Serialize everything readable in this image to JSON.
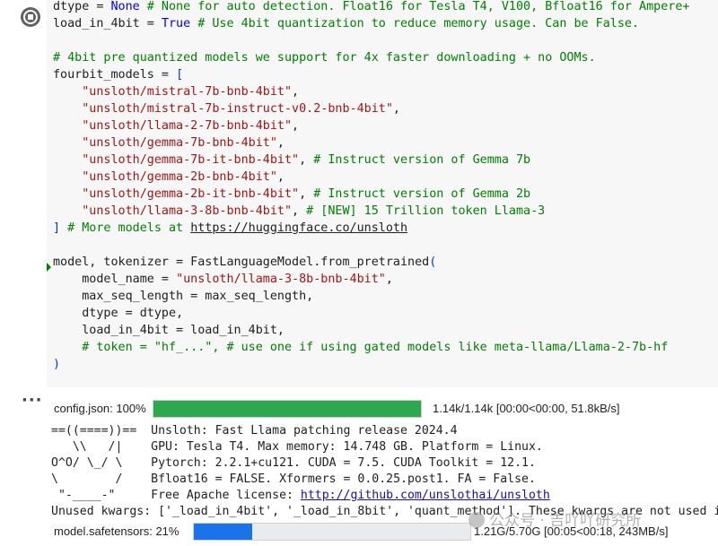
{
  "code": {
    "lines": [
      [
        {
          "t": "dtype = "
        },
        {
          "t": "None",
          "c": "kw"
        },
        {
          "t": " # None for auto detection. Float16 for Tesla T4, V100, Bfloat16 for Ampere+",
          "c": "com"
        }
      ],
      [
        {
          "t": "load_in_4bit = "
        },
        {
          "t": "True",
          "c": "kw"
        },
        {
          "t": " # Use 4bit quantization to reduce memory usage. Can be False.",
          "c": "com"
        }
      ],
      [],
      [
        {
          "t": "# 4bit pre quantized models we support for 4x faster downloading + no OOMs.",
          "c": "com"
        }
      ],
      [
        {
          "t": "fourbit_models = "
        },
        {
          "t": "[",
          "c": "br"
        }
      ],
      [
        {
          "t": "    "
        },
        {
          "t": "\"unsloth/mistral-7b-bnb-4bit\"",
          "c": "str"
        },
        {
          "t": ","
        }
      ],
      [
        {
          "t": "    "
        },
        {
          "t": "\"unsloth/mistral-7b-instruct-v0.2-bnb-4bit\"",
          "c": "str"
        },
        {
          "t": ","
        }
      ],
      [
        {
          "t": "    "
        },
        {
          "t": "\"unsloth/llama-2-7b-bnb-4bit\"",
          "c": "str"
        },
        {
          "t": ","
        }
      ],
      [
        {
          "t": "    "
        },
        {
          "t": "\"unsloth/gemma-7b-bnb-4bit\"",
          "c": "str"
        },
        {
          "t": ","
        }
      ],
      [
        {
          "t": "    "
        },
        {
          "t": "\"unsloth/gemma-7b-it-bnb-4bit\"",
          "c": "str"
        },
        {
          "t": ", "
        },
        {
          "t": "# Instruct version of Gemma 7b",
          "c": "com"
        }
      ],
      [
        {
          "t": "    "
        },
        {
          "t": "\"unsloth/gemma-2b-bnb-4bit\"",
          "c": "str"
        },
        {
          "t": ","
        }
      ],
      [
        {
          "t": "    "
        },
        {
          "t": "\"unsloth/gemma-2b-it-bnb-4bit\"",
          "c": "str"
        },
        {
          "t": ", "
        },
        {
          "t": "# Instruct version of Gemma 2b",
          "c": "com"
        }
      ],
      [
        {
          "t": "    "
        },
        {
          "t": "\"unsloth/llama-3-8b-bnb-4bit\"",
          "c": "str"
        },
        {
          "t": ", "
        },
        {
          "t": "# [NEW] 15 Trillion token Llama-3",
          "c": "com"
        }
      ],
      [
        {
          "t": "]",
          "c": "br"
        },
        {
          "t": " # More models at ",
          "c": "com"
        },
        {
          "t": "https://huggingface.co/unsloth",
          "c": "link"
        }
      ],
      [],
      [
        {
          "t": "model, tokenizer = FastLanguageModel.from_pretrained"
        },
        {
          "t": "(",
          "c": "br"
        }
      ],
      [
        {
          "t": "    model_name = "
        },
        {
          "t": "\"unsloth/llama-3-8b-bnb-4bit\"",
          "c": "str"
        },
        {
          "t": ","
        }
      ],
      [
        {
          "t": "    max_seq_length = max_seq_length,"
        }
      ],
      [
        {
          "t": "    dtype = dtype,"
        }
      ],
      [
        {
          "t": "    load_in_4bit = load_in_4bit,"
        }
      ],
      [
        {
          "t": "    "
        },
        {
          "t": "# token = \"hf_...\", # use one if using gated models like meta-llama/Llama-2-7b-hf",
          "c": "com"
        }
      ],
      [
        {
          "t": ")",
          "c": "br"
        }
      ]
    ]
  },
  "output": {
    "progress1": {
      "label": "config.json: 100%",
      "stats": "1.14k/1.14k [00:00<00:00, 51.8kB/s]",
      "fraction": 1.0
    },
    "log_lines": [
      "==((====))==  Unsloth: Fast Llama patching release 2024.4",
      "   \\\\   /|    GPU: Tesla T4. Max memory: 14.748 GB. Platform = Linux.",
      "O^O/ \\_/ \\    Pytorch: 2.2.1+cu121. CUDA = 7.5. CUDA Toolkit = 12.1.",
      "\\        /    Bfloat16 = FALSE. Xformers = 0.0.25.post1. FA = False.",
      " \"-____-\"     Free Apache license: ",
      "Unused kwargs: ['_load_in_4bit', '_load_in_8bit', 'quant_method']. These kwargs are not used in"
    ],
    "license_link": "http://github.com/unslothai/unsloth",
    "progress2": {
      "label": "model.safetensors:  21%",
      "stats": "1.21G/5.70G [00:05<00:18, 243MB/s]",
      "fraction": 0.21
    }
  },
  "watermark": "公众号 · 吉吖吖研究所",
  "colors": {
    "keyword": "#0000ff",
    "string": "#a31515",
    "comment": "#008000",
    "progress_done": "#2ea84f",
    "progress_active": "#1a73e8"
  }
}
